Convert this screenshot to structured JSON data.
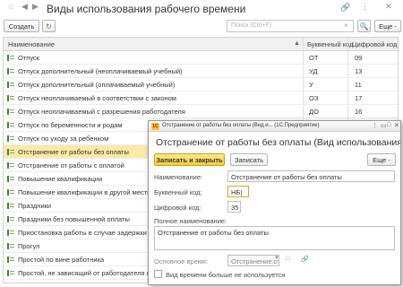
{
  "header": {
    "title": "Виды использования рабочего времени",
    "star_icon": "☆",
    "back_icon": "◀",
    "forward_icon": "▶",
    "link_icon": "🔗",
    "more_icon": "⋮",
    "close_icon": "✕"
  },
  "toolbar": {
    "create_label": "Создать",
    "refresh_icon": "↻",
    "search_placeholder": "Поиск (Ctrl+F)",
    "search_clear_icon": "×",
    "search_icon": "🔍",
    "more_label": "Еще -"
  },
  "table": {
    "columns": [
      "Наименование",
      "Буквенный код",
      "Цифровой код"
    ],
    "sort_icon": "▲",
    "rows": [
      {
        "name": "Отпуск",
        "letter": "ОТ",
        "digit": "09"
      },
      {
        "name": "Отпуск дополнительный (неоплачиваемый учебный)",
        "letter": "УД",
        "digit": "13"
      },
      {
        "name": "Отпуск дополнительный (оплачиваемый учебный)",
        "letter": "У",
        "digit": "11"
      },
      {
        "name": "Отпуск неоплачиваемый в соответствии с законом",
        "letter": "ОЗ",
        "digit": "17"
      },
      {
        "name": "Отпуск неоплачиваемый с разрешения работодателя",
        "letter": "ДО",
        "digit": "16"
      },
      {
        "name": "Отпуск по беременности и родам",
        "letter": "",
        "digit": ""
      },
      {
        "name": "Отпуск по уходу за ребенком",
        "letter": "",
        "digit": ""
      },
      {
        "name": "Отстранение от работы без оплаты",
        "letter": "",
        "digit": ""
      },
      {
        "name": "Отстранение от работы с оплатой",
        "letter": "",
        "digit": ""
      },
      {
        "name": "Повышение квалификации",
        "letter": "",
        "digit": ""
      },
      {
        "name": "Повышение квалификации в другой местности",
        "letter": "",
        "digit": ""
      },
      {
        "name": "Праздники",
        "letter": "",
        "digit": ""
      },
      {
        "name": "Праздники без повышенной оплаты",
        "letter": "",
        "digit": ""
      },
      {
        "name": "Приостановка работы в случае задержки выпл",
        "letter": "",
        "digit": ""
      },
      {
        "name": "Прогул",
        "letter": "",
        "digit": ""
      },
      {
        "name": "Простой по вине работника",
        "letter": "",
        "digit": ""
      },
      {
        "name": "Простой, не зависящий от работодателя и работ",
        "letter": "",
        "digit": ""
      }
    ],
    "selected_index": 7,
    "selection_color": "#fbe9a6"
  },
  "dialog": {
    "window_title": "Отстранение от работы без оплаты (Вид и... (1С:Предприятие)",
    "logo_text": "1С",
    "more_icon": "⋮",
    "minimize_icon": "▭",
    "maximize_icon": "□",
    "close_icon": "✕",
    "title": "Отстранение от работы без оплаты (Вид использования р...",
    "save_close_label": "Записать и закрыть",
    "save_label": "Записать",
    "more_label": "Еще -",
    "name_label": "Наименование:",
    "name_value": "Отстранение от работы без оплаты",
    "letter_label": "Буквенный код:",
    "letter_value": "НБ|",
    "digit_label": "Цифровой код:",
    "digit_value": "35",
    "fullname_label": "Полное наименование:",
    "fullname_value": "Отстранение от работы без оплаты",
    "basic_label": "Основное время:",
    "basic_value": "Отстранение от работы бє",
    "basic_drop_icon": "▼",
    "basic_open_icon": "□",
    "basic_link_icon": "🔗",
    "unused_label": "Вид времени больше не используется",
    "unused_checked": false,
    "accent_color": "#f4ce3e"
  }
}
